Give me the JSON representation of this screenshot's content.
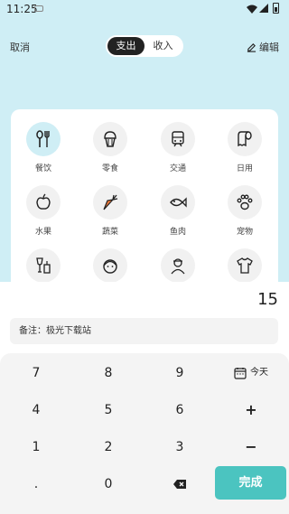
{
  "status_bar": {
    "time": "11:25"
  },
  "header": {
    "cancel_label": "取消",
    "tab_expense": "支出",
    "tab_income": "收入",
    "edit_label": "编辑"
  },
  "categories": [
    {
      "label": "餐饮",
      "icon": "fork-knife-icon",
      "selected": true
    },
    {
      "label": "零食",
      "icon": "cupcake-icon"
    },
    {
      "label": "交通",
      "icon": "train-icon"
    },
    {
      "label": "日用",
      "icon": "tissue-roll-icon"
    },
    {
      "label": "水果",
      "icon": "apple-icon"
    },
    {
      "label": "蔬菜",
      "icon": "carrot-icon"
    },
    {
      "label": "鱼肉",
      "icon": "fish-icon"
    },
    {
      "label": "宠物",
      "icon": "paw-icon"
    },
    {
      "label": "",
      "icon": "wine-drink-icon"
    },
    {
      "label": "",
      "icon": "child-face-icon"
    },
    {
      "label": "",
      "icon": "elder-person-icon"
    },
    {
      "label": "",
      "icon": "tshirt-icon"
    }
  ],
  "amount": "15",
  "remark": "备注：极光下载站",
  "keypad": {
    "r1": [
      "7",
      "8",
      "9"
    ],
    "today": "今天",
    "r2": [
      "4",
      "5",
      "6"
    ],
    "plus": "+",
    "r3": [
      "1",
      "2",
      "3"
    ],
    "minus": "−",
    "r4": [
      ".",
      "0"
    ],
    "done": "完成"
  },
  "colors": {
    "top_bg": "#cfeef5",
    "accent": "#4bc4c0",
    "dark": "#222222"
  }
}
